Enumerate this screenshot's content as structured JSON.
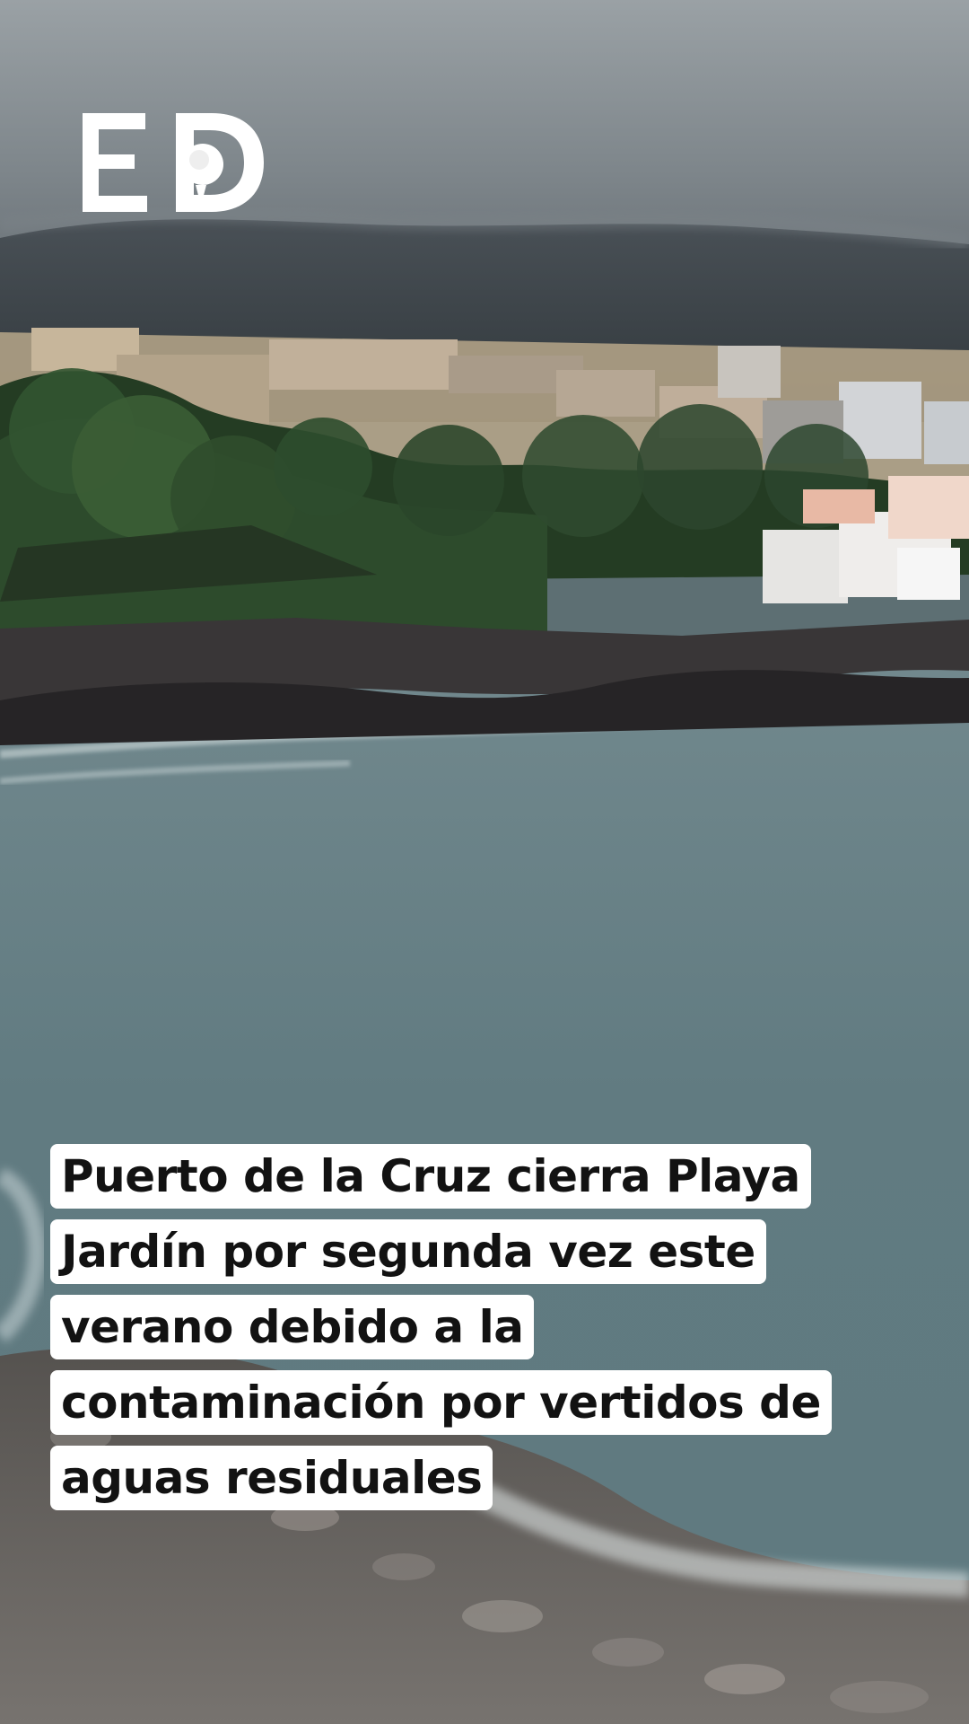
{
  "brand": {
    "logo_text": "ED"
  },
  "headline": {
    "lines": [
      "Puerto de la Cruz cierra Playa",
      "Jardín por segunda vez este",
      "verano debido a la",
      "contaminación por vertidos de",
      "aguas residuales"
    ]
  },
  "colors": {
    "caption_background": "#ffffff",
    "caption_text": "#121212",
    "sea": "#6c8186",
    "sky": "#8f959b",
    "rocks": "#6f6c68"
  }
}
